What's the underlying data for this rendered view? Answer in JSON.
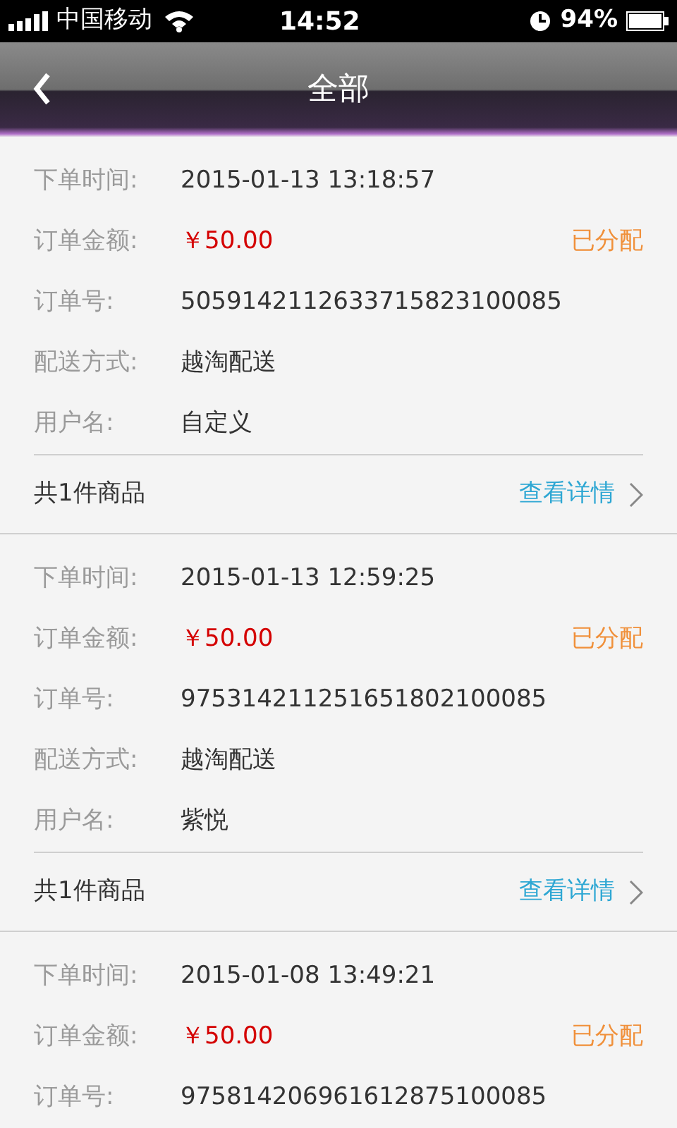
{
  "status_bar": {
    "carrier": "中国移动",
    "time": "14:52",
    "battery": "94%"
  },
  "header": {
    "title": "全部"
  },
  "orders": [
    {
      "status": "已分配",
      "fields": [
        {
          "kind": "text",
          "label": "下单时间:",
          "value": "2015-01-13 13:18:57"
        },
        {
          "kind": "price",
          "label": "订单金额:",
          "value": "￥50.00"
        },
        {
          "kind": "text",
          "label": "订单号:",
          "value": "5059142112633715823100085"
        },
        {
          "kind": "text",
          "label": "配送方式:",
          "value": "越淘配送"
        },
        {
          "kind": "text",
          "label": "用户名:",
          "value": "自定义"
        }
      ],
      "item_count": "共1件商品",
      "details_link": "查看详情"
    },
    {
      "status": "已分配",
      "fields": [
        {
          "kind": "text",
          "label": "下单时间:",
          "value": "2015-01-13 12:59:25"
        },
        {
          "kind": "price",
          "label": "订单金额:",
          "value": "￥50.00"
        },
        {
          "kind": "text",
          "label": "订单号:",
          "value": "975314211251651802100085"
        },
        {
          "kind": "text",
          "label": "配送方式:",
          "value": "越淘配送"
        },
        {
          "kind": "text",
          "label": "用户名:",
          "value": "紫悦"
        }
      ],
      "item_count": "共1件商品",
      "details_link": "查看详情"
    },
    {
      "status": "已分配",
      "fields": [
        {
          "kind": "text",
          "label": "下单时间:",
          "value": "2015-01-08 13:49:21"
        },
        {
          "kind": "price",
          "label": "订单金额:",
          "value": "￥50.00"
        },
        {
          "kind": "text",
          "label": "订单号:",
          "value": "975814206961612875100085"
        }
      ]
    }
  ]
}
